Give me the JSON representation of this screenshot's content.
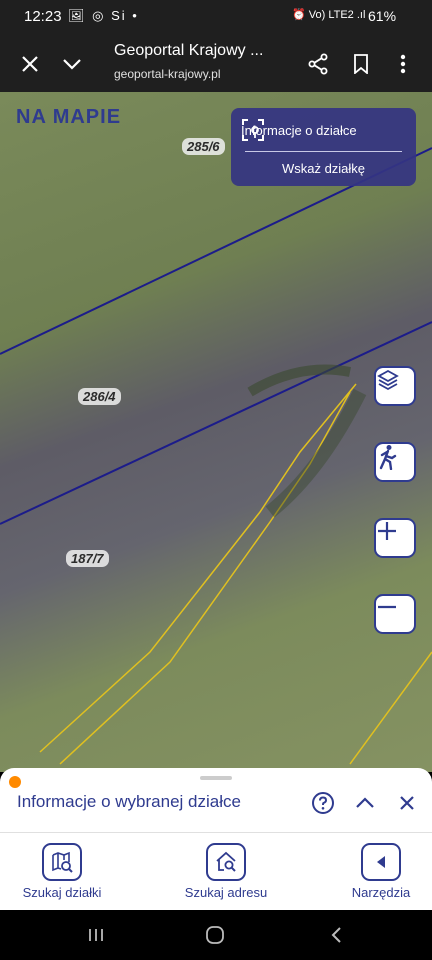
{
  "status_bar": {
    "time": "12:23",
    "left_icons": "🖼 ◎ Si •",
    "right_icons": "⏰ Vo) LTE2 .ıl",
    "battery": "61%"
  },
  "browser": {
    "title": "Geoportal Krajowy ...",
    "url": "geoportal-krajowy.pl"
  },
  "map": {
    "logo": "NA MAPIE",
    "parcels": [
      "285/6",
      "286/4",
      "187/7"
    ],
    "info_panel": {
      "title": "Informacje o działce",
      "action": "Wskaż działkę"
    }
  },
  "sheet": {
    "title": "Informacje o wybranej działce"
  },
  "tabs": [
    {
      "label": "Szukaj działki"
    },
    {
      "label": "Szukaj adresu"
    },
    {
      "label": "Narzędzia"
    }
  ],
  "colors": {
    "accent": "#2f3b8f",
    "indicator": "#ff8a00"
  }
}
